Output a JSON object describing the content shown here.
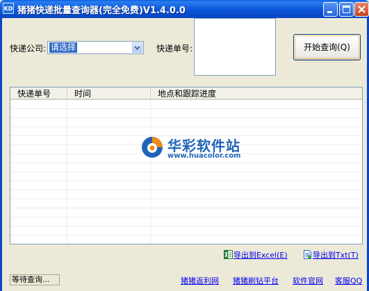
{
  "window": {
    "title": "猪猪快递批量查询器(完全免费)V1.4.0.0",
    "icon_text": "KD",
    "controls": [
      "minimize-icon",
      "maximize-icon",
      "close-icon"
    ]
  },
  "form": {
    "company_label": "快递公司:",
    "company_selected": "请选择",
    "number_label": "快递单号:",
    "numbers_value": "",
    "start_button": "开始查询(Q)"
  },
  "results": {
    "columns": [
      "快递单号",
      "时间",
      "地点和跟踪进度"
    ],
    "rows": []
  },
  "watermark": {
    "title": "华彩软件站",
    "url": "www.huacolor.com"
  },
  "export": {
    "excel_label": "导出到Excel(E)",
    "txt_label": "导出到Txt(T)",
    "excel_icon": "excel-icon",
    "txt_icon": "text-file-icon"
  },
  "status": {
    "text": "等待查询..."
  },
  "footer_links": [
    "猪猪返利网",
    "猪猪刷钻平台",
    "软件官网",
    "客服QQ"
  ],
  "colors": {
    "titlebar": "#0A55D8",
    "selection": "#316AC5",
    "link": "#0000EE",
    "window_bg": "#ECE9D8"
  }
}
